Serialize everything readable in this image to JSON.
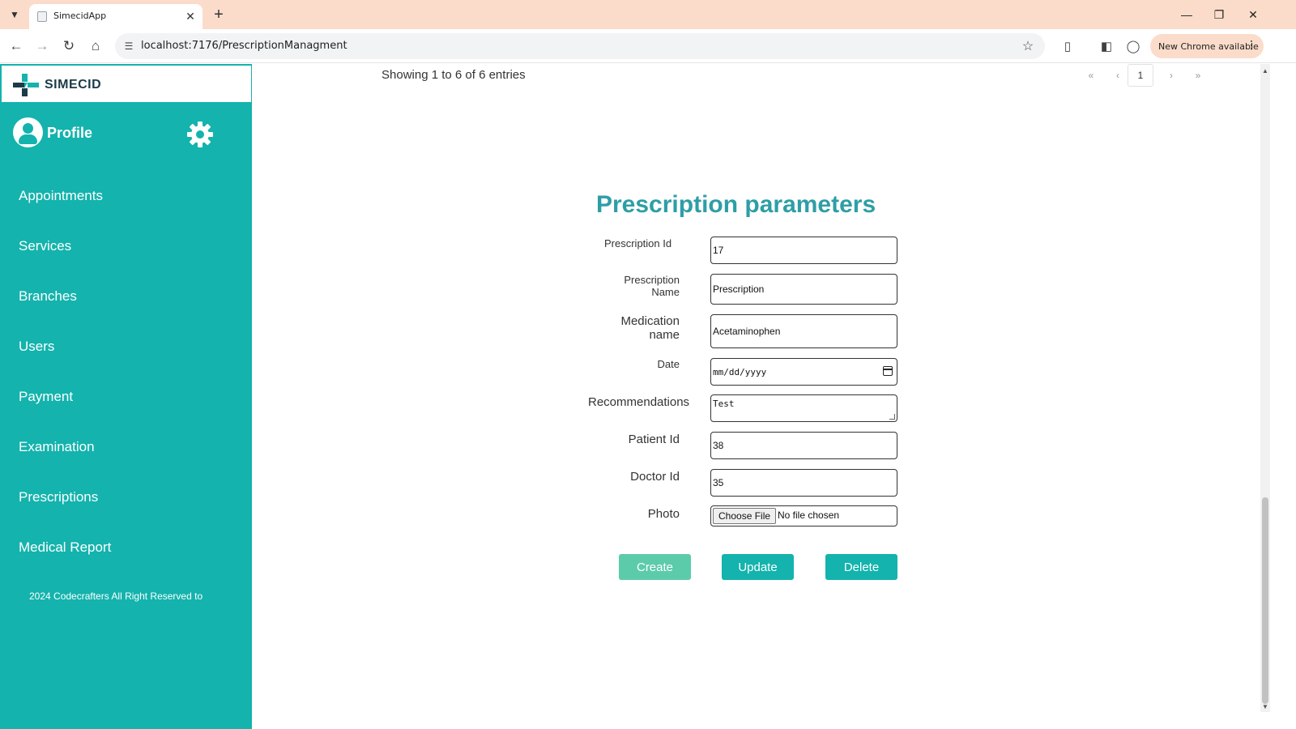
{
  "browser": {
    "tab_title": "SimecidApp",
    "url": "localhost:7176/PrescriptionManagment",
    "update_chip": "New Chrome available"
  },
  "sidebar": {
    "brand_name": "SIMECID",
    "profile_label": "Profile",
    "items": [
      {
        "label": "Appointments"
      },
      {
        "label": "Services"
      },
      {
        "label": "Branches"
      },
      {
        "label": "Users"
      },
      {
        "label": "Payment"
      },
      {
        "label": "Examination"
      },
      {
        "label": "Prescriptions"
      },
      {
        "label": "Medical Report"
      }
    ],
    "footer": "2024 Codecrafters All Right Reserved to"
  },
  "table_info": {
    "entries_text": "Showing 1 to 6 of 6 entries",
    "pager": {
      "first": "«",
      "prev": "‹",
      "current": "1",
      "next": "›",
      "last": "»"
    }
  },
  "form": {
    "title": "Prescription parameters",
    "fields": {
      "prescription_id": {
        "label": "Prescription Id",
        "value": "17"
      },
      "prescription_name": {
        "label_line1": "Prescription",
        "label_line2": "Name",
        "value": "Prescription"
      },
      "medication_name": {
        "label_line1": "Medication",
        "label_line2": "name",
        "value": "Acetaminophen"
      },
      "date": {
        "label": "Date",
        "placeholder": "mm/dd/yyyy"
      },
      "recommendations": {
        "label": "Recommendations",
        "value": "Test"
      },
      "patient_id": {
        "label": "Patient Id",
        "value": "38"
      },
      "doctor_id": {
        "label": "Doctor Id",
        "value": "35"
      },
      "photo": {
        "label": "Photo",
        "button": "Choose File",
        "status": "No file chosen"
      }
    },
    "buttons": {
      "create": "Create",
      "update": "Update",
      "delete": "Delete"
    }
  },
  "colors": {
    "sidebar_bg": "#14b3ad",
    "title_color": "#2e9ea6",
    "create_btn": "#5ccbaa",
    "primary_btn": "#14b3ad",
    "tab_strip": "#fbdcca"
  }
}
